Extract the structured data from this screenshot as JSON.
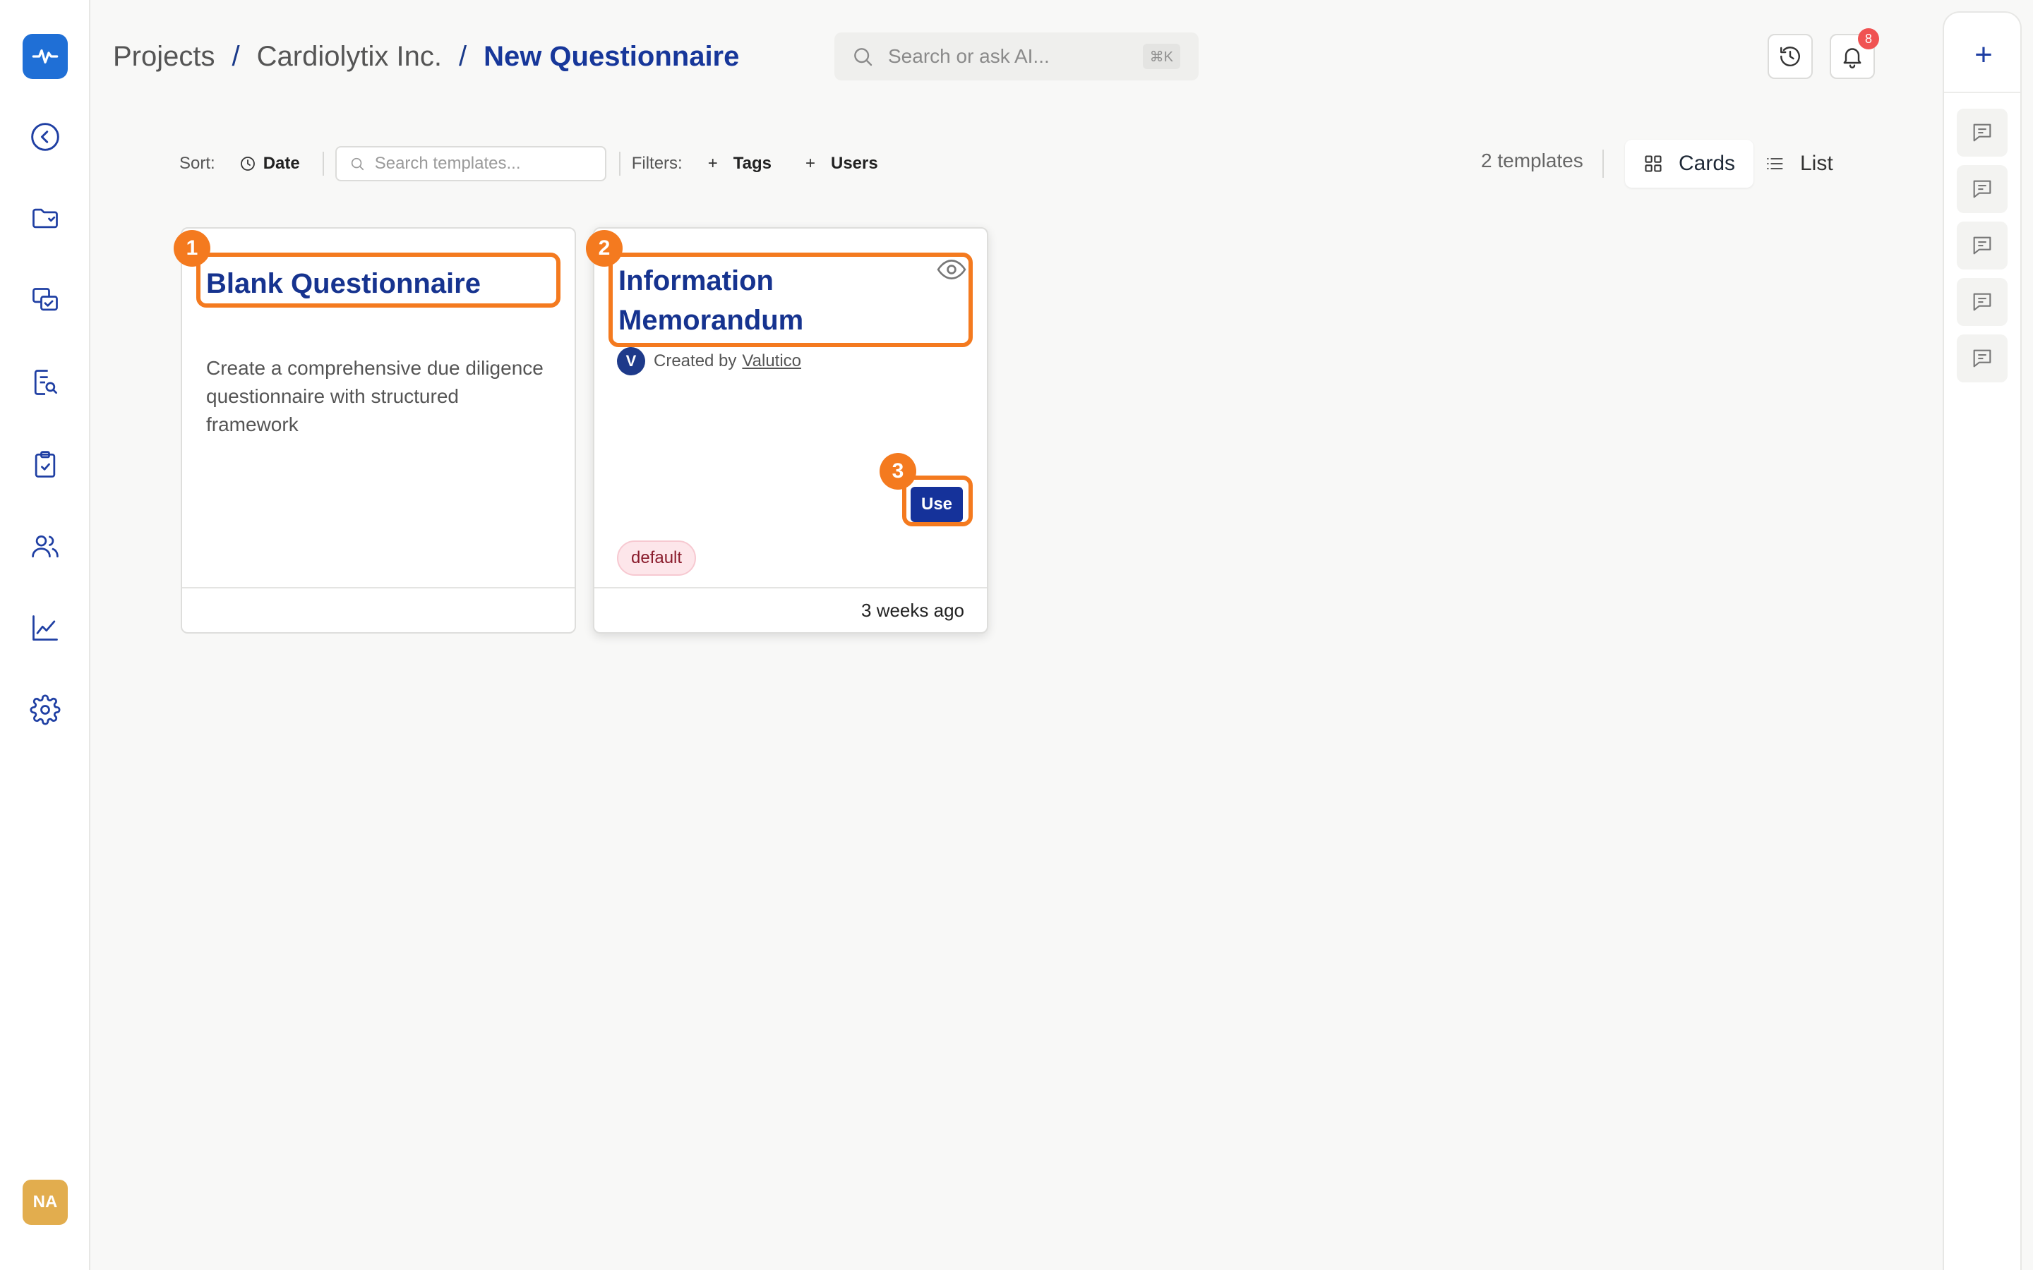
{
  "sidebar": {
    "logo_icon": "heartbeat-logo-icon",
    "items": [
      {
        "icon": "back-arrow-icon"
      },
      {
        "icon": "folder-icon"
      },
      {
        "icon": "chat-check-icon"
      },
      {
        "icon": "document-search-icon"
      },
      {
        "icon": "clipboard-icon"
      },
      {
        "icon": "users-icon"
      },
      {
        "icon": "chart-line-icon"
      },
      {
        "icon": "gear-icon"
      }
    ],
    "avatar_initials": "NA"
  },
  "header": {
    "breadcrumb": [
      "Projects",
      "Cardiolytix Inc.",
      "New Questionnaire"
    ],
    "separator": "/",
    "search_placeholder": "Search or ask AI...",
    "search_shortcut": "⌘K",
    "notification_count": "8"
  },
  "toolbar": {
    "sort_label": "Sort:",
    "sort_value": "Date",
    "template_search_placeholder": "Search templates...",
    "filters_label": "Filters:",
    "filter_tags": "Tags",
    "filter_users": "Users",
    "plus": "+",
    "template_count": "2 templates",
    "view_cards": "Cards",
    "view_list": "List"
  },
  "cards": [
    {
      "title": "Blank Questionnaire",
      "description": "Create a comprehensive due diligence questionnaire with structured framework"
    },
    {
      "title": "Information Memorandum",
      "creator_prefix": "Created by",
      "creator_name": "Valutico",
      "creator_logo": "V",
      "tag": "default",
      "use_label": "Use",
      "time": "3 weeks ago"
    }
  ],
  "annotations": [
    "1",
    "2",
    "3"
  ],
  "colors": {
    "accent": "#16338f",
    "highlight": "#f47a1f",
    "logo": "#1f6fd6",
    "avatar": "#e2ad4e",
    "badge": "#f05252"
  }
}
